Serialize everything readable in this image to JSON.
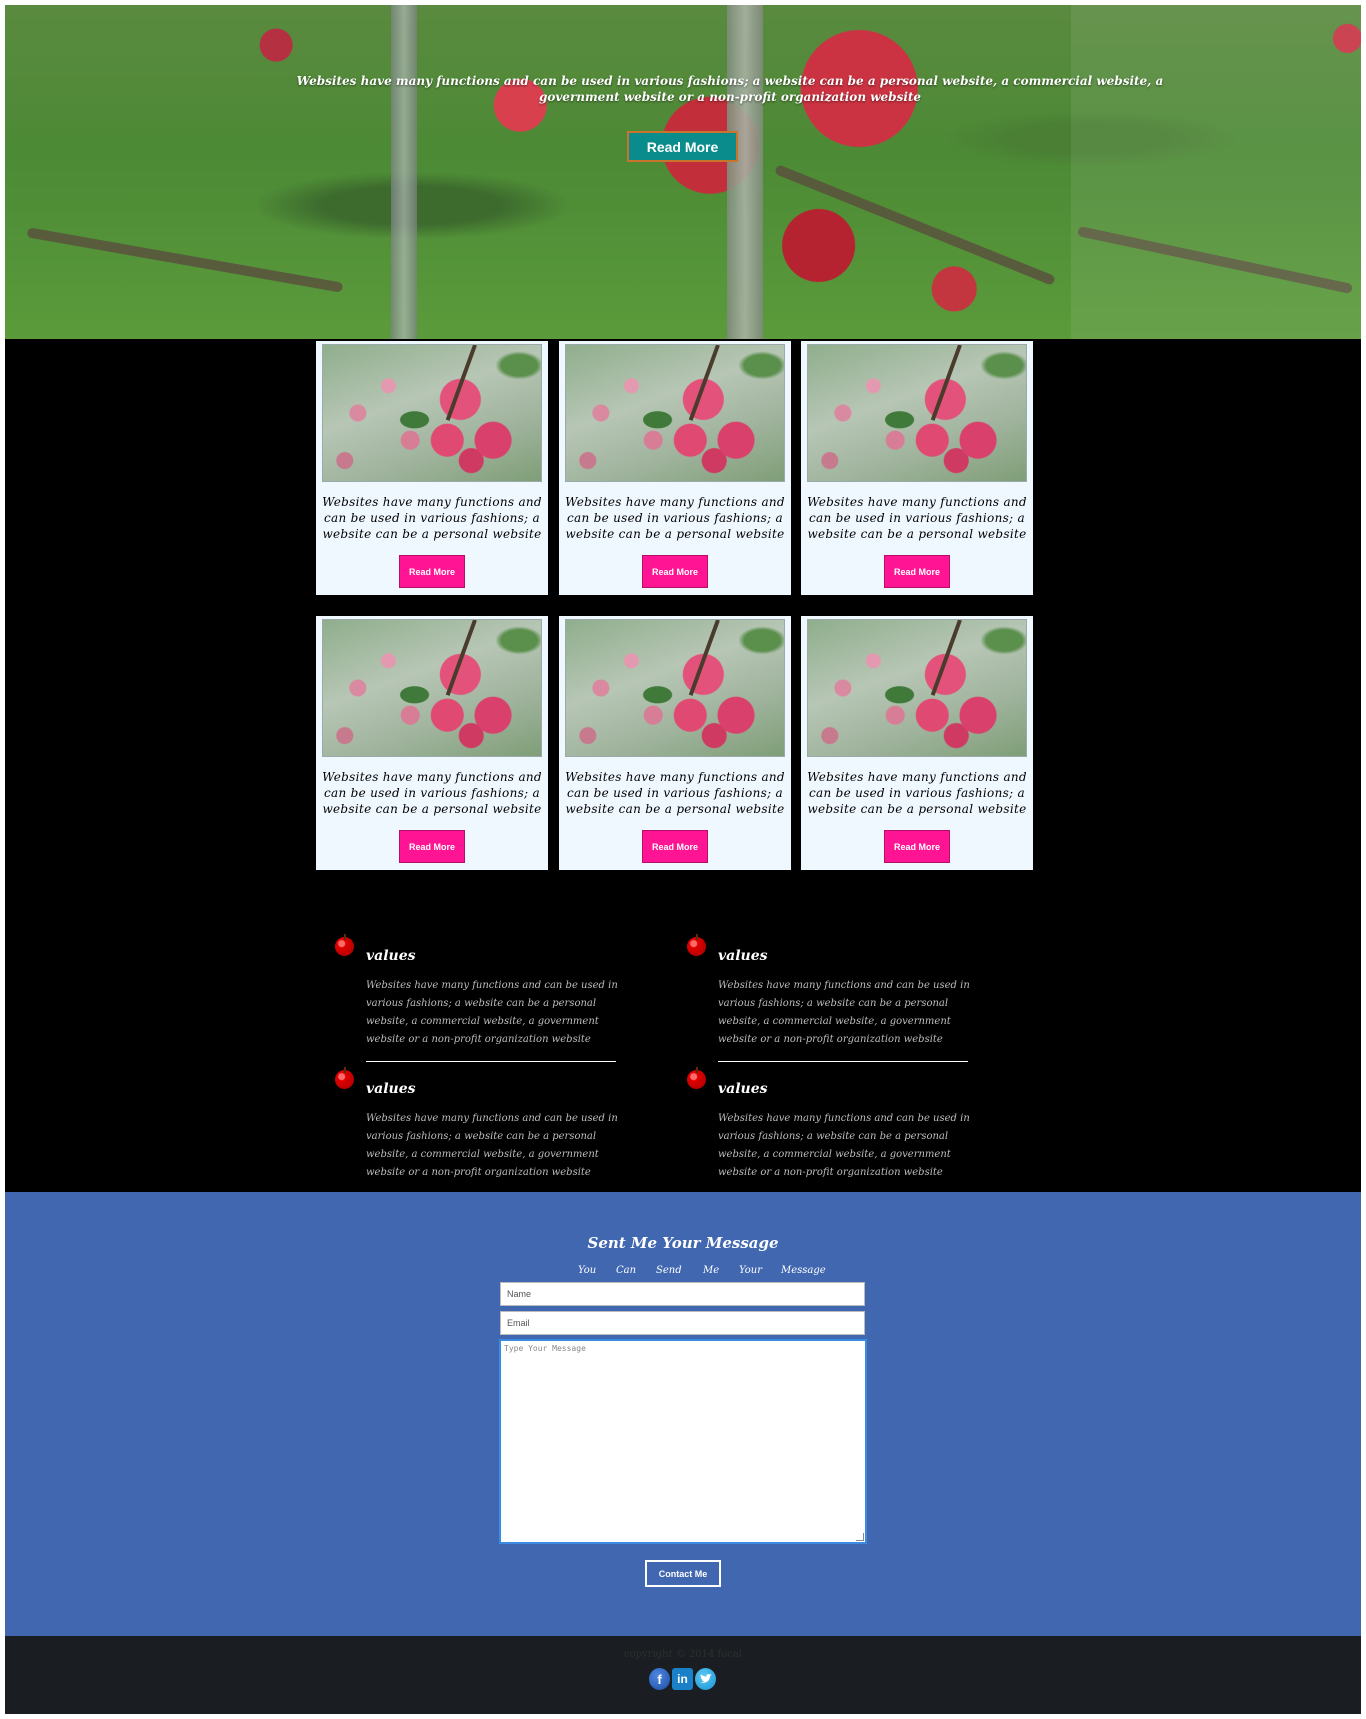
{
  "hero": {
    "text": "Websites have many functions and can be used in various fashions; a website can be a personal website, a commercial website, a government website or a non-profit organization website",
    "button_label": "Read More"
  },
  "cards": [
    {
      "text": "Websites have many functions and can be used in various fashions; a website can be a personal website",
      "button_label": "Read More"
    },
    {
      "text": "Websites have many functions and can be used in various fashions; a website can be a personal website",
      "button_label": "Read More"
    },
    {
      "text": "Websites have many functions and can be used in various fashions; a website can be a personal website",
      "button_label": "Read More"
    },
    {
      "text": "Websites have many functions and can be used in various fashions; a website can be a personal website",
      "button_label": "Read More"
    },
    {
      "text": "Websites have many functions and can be used in various fashions; a website can be a personal website",
      "button_label": "Read More"
    },
    {
      "text": "Websites have many functions and can be used in various fashions; a website can be a personal website",
      "button_label": "Read More"
    }
  ],
  "values": [
    {
      "title": "values",
      "text": "Websites have many functions and can be used in various fashions; a website can be a personal website, a commercial website, a government website or a non-profit organization website"
    },
    {
      "title": "values",
      "text": "Websites have many functions and can be used in various fashions; a website can be a personal website, a commercial website, a government website or a non-profit organization website"
    },
    {
      "title": "values",
      "text": "Websites have many functions and can be used in various fashions; a website can be a personal website, a commercial website, a government website or a non-profit organization website"
    },
    {
      "title": "values",
      "text": "Websites have many functions and can be used in various fashions; a website can be a personal website, a commercial website, a government website or a non-profit organization website"
    }
  ],
  "contact": {
    "heading": "Sent Me Your Message",
    "subtitle_words": [
      "You",
      "Can",
      "Send",
      "Me",
      "Your",
      "Message"
    ],
    "name_placeholder": "Name",
    "email_placeholder": "Email",
    "message_placeholder": "Type Your Message",
    "button_label": "Contact Me"
  },
  "footer": {
    "copyright": "copyright © 2014 focal",
    "social_icons": [
      "facebook-icon",
      "linkedin-icon",
      "twitter-icon"
    ]
  },
  "colors": {
    "hero_button": "#0a8c8c",
    "card_button": "#ff1493",
    "card_bg": "#f0f8ff",
    "contact_bg": "#4167b1",
    "footer_bg": "#1a1e22"
  }
}
